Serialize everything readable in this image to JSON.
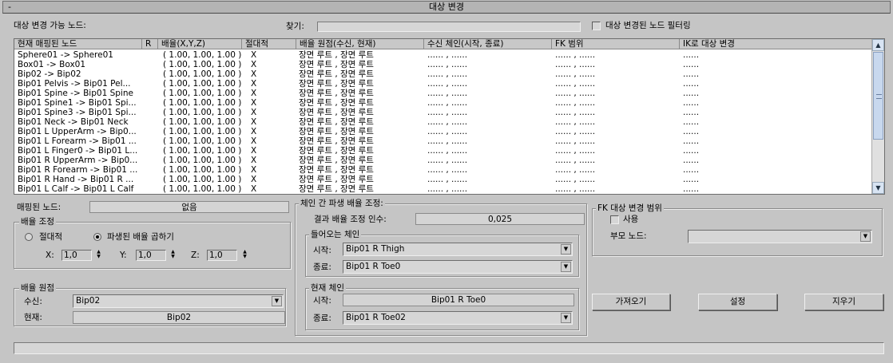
{
  "rollout": {
    "title": "대상 변경",
    "collapse_glyph": "-"
  },
  "top": {
    "retargetable_label": "대상 변경 가능 노드:",
    "search_label": "찾기:",
    "search_value": "",
    "filter_label": "대상 변경된 노드 필터링"
  },
  "list": {
    "columns": [
      "현재 매핑된 노드",
      "R",
      "배율(X,Y,Z)",
      "절대적",
      "배율 원점(수신, 현재)",
      "수신 체인(시작, 종료)",
      "FK 범위",
      "IK로 대상 변경"
    ],
    "rows": [
      [
        "Sphere01 -> Sphere01",
        "",
        "( 1.00, 1.00, 1.00 )",
        "X",
        "장면 루트 , 장면 루트",
        "...... , ......",
        "...... , ......",
        "......"
      ],
      [
        "Box01 -> Box01",
        "",
        "( 1.00, 1.00, 1.00 )",
        "X",
        "장면 루트 , 장면 루트",
        "...... , ......",
        "...... , ......",
        "......"
      ],
      [
        "Bip02 -> Bip02",
        "",
        "( 1.00, 1.00, 1.00 )",
        "X",
        "장면 루트 , 장면 루트",
        "...... , ......",
        "...... , ......",
        "......"
      ],
      [
        "Bip01 Pelvis -> Bip01 Pel...",
        "",
        "( 1.00, 1.00, 1.00 )",
        "X",
        "장면 루트 , 장면 루트",
        "...... , ......",
        "...... , ......",
        "......"
      ],
      [
        "Bip01 Spine -> Bip01 Spine",
        "",
        "( 1.00, 1.00, 1.00 )",
        "X",
        "장면 루트 , 장면 루트",
        "...... , ......",
        "...... , ......",
        "......"
      ],
      [
        "Bip01 Spine1 -> Bip01 Spi...",
        "",
        "( 1.00, 1.00, 1.00 )",
        "X",
        "장면 루트 , 장면 루트",
        "...... , ......",
        "...... , ......",
        "......"
      ],
      [
        "Bip01 Spine3 -> Bip01 Spi...",
        "",
        "( 1.00, 1.00, 1.00 )",
        "X",
        "장면 루트 , 장면 루트",
        "...... , ......",
        "...... , ......",
        "......"
      ],
      [
        "Bip01 Neck -> Bip01 Neck",
        "",
        "( 1.00, 1.00, 1.00 )",
        "X",
        "장면 루트 , 장면 루트",
        "...... , ......",
        "...... , ......",
        "......"
      ],
      [
        "Bip01 L UpperArm -> Bip0...",
        "",
        "( 1.00, 1.00, 1.00 )",
        "X",
        "장면 루트 , 장면 루트",
        "...... , ......",
        "...... , ......",
        "......"
      ],
      [
        "Bip01 L Forearm -> Bip01 ...",
        "",
        "( 1.00, 1.00, 1.00 )",
        "X",
        "장면 루트 , 장면 루트",
        "...... , ......",
        "...... , ......",
        "......"
      ],
      [
        "Bip01 L Finger0 -> Bip01 L...",
        "",
        "( 1.00, 1.00, 1.00 )",
        "X",
        "장면 루트 , 장면 루트",
        "...... , ......",
        "...... , ......",
        "......"
      ],
      [
        "Bip01 R UpperArm -> Bip0...",
        "",
        "( 1.00, 1.00, 1.00 )",
        "X",
        "장면 루트 , 장면 루트",
        "...... , ......",
        "...... , ......",
        "......"
      ],
      [
        "Bip01 R Forearm -> Bip01 ...",
        "",
        "( 1.00, 1.00, 1.00 )",
        "X",
        "장면 루트 , 장면 루트",
        "...... , ......",
        "...... , ......",
        "......"
      ],
      [
        "Bip01 R Hand -> Bip01 R ...",
        "",
        "( 1.00, 1.00, 1.00 )",
        "X",
        "장면 루트 , 장면 루트",
        "...... , ......",
        "...... , ......",
        "......"
      ],
      [
        "Bip01 L Calf -> Bip01 L Calf",
        "",
        "( 1.00, 1.00, 1.00 )",
        "X",
        "장면 루트 , 장면 루트",
        "...... , ......",
        "...... , ......",
        "......"
      ]
    ],
    "scroll_up": "▲",
    "scroll_down": "▼"
  },
  "mapped": {
    "label": "매핑된 노드:",
    "value": "없음"
  },
  "scale_adjust": {
    "title": "배율 조정",
    "absolute": "절대적",
    "derived": "파생된 배율 곱하기",
    "x_label": "X:",
    "x_value": "1,0",
    "y_label": "Y:",
    "y_value": "1,0",
    "z_label": "Z:",
    "z_value": "1,0"
  },
  "scale_origin": {
    "title": "배율 원점",
    "receive_label": "수신:",
    "receive_value": "Bip02",
    "current_label": "현재:",
    "current_value": "Bip02"
  },
  "chain": {
    "title": "체인 간 파생 배율 조정:",
    "factor_label": "결과 배율 조정 인수:",
    "factor_value": "0,025",
    "incoming_title": "들어오는 체인",
    "in_start_label": "시작:",
    "in_start_value": "Bip01 R Thigh",
    "in_end_label": "종료:",
    "in_end_value": "Bip01 R Toe0",
    "current_title": "현재 체인",
    "cur_start_label": "시작:",
    "cur_start_value": "Bip01 R Toe0",
    "cur_end_label": "종료:",
    "cur_end_value": "Bip01 R Toe02"
  },
  "fk": {
    "title": "FK 대상 변경 범위",
    "use_label": "사용",
    "parent_label": "부모 노드:",
    "parent_value": ""
  },
  "buttons": {
    "get": "가져오기",
    "set": "설정",
    "clear": "지우기"
  },
  "icons": {
    "dropdown": "▼",
    "spin_up": "▲",
    "spin_down": "▼"
  }
}
